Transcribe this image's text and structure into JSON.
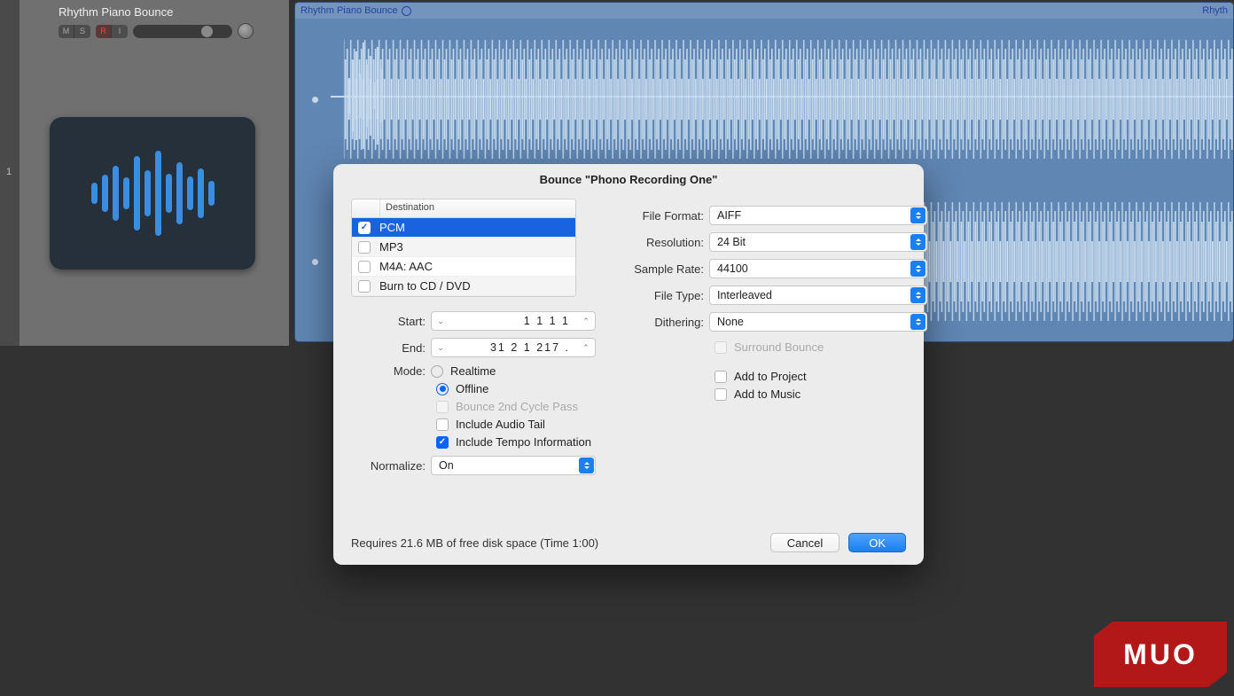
{
  "track": {
    "number": "1",
    "name": "Rhythm Piano Bounce",
    "buttons": {
      "m": "M",
      "s": "S",
      "r": "R",
      "i": "I"
    }
  },
  "clip": {
    "name_left": "Rhythm Piano Bounce",
    "name_right": "Rhyth"
  },
  "dialog": {
    "title": "Bounce \"Phono Recording One\"",
    "dest_header": "Destination",
    "destinations": [
      {
        "label": "PCM",
        "checked": true,
        "selected": true
      },
      {
        "label": "MP3",
        "checked": false,
        "selected": false
      },
      {
        "label": "M4A: AAC",
        "checked": false,
        "selected": false
      },
      {
        "label": "Burn to CD / DVD",
        "checked": false,
        "selected": false
      }
    ],
    "start_label": "Start:",
    "start_value": "1  1  1      1",
    "end_label": "End:",
    "end_value": "31  2  1  217 .",
    "mode_label": "Mode:",
    "mode_realtime": "Realtime",
    "mode_offline": "Offline",
    "bounce2nd": "Bounce 2nd Cycle Pass",
    "include_tail": "Include Audio Tail",
    "include_tempo": "Include Tempo Information",
    "normalize_label": "Normalize:",
    "normalize_value": "On",
    "file_format_label": "File Format:",
    "file_format_value": "AIFF",
    "resolution_label": "Resolution:",
    "resolution_value": "24 Bit",
    "sample_rate_label": "Sample Rate:",
    "sample_rate_value": "44100",
    "file_type_label": "File Type:",
    "file_type_value": "Interleaved",
    "dithering_label": "Dithering:",
    "dithering_value": "None",
    "surround": "Surround Bounce",
    "add_project": "Add to Project",
    "add_music": "Add to Music",
    "footer_status": "Requires 21.6 MB of free disk space  (Time 1:00)",
    "cancel": "Cancel",
    "ok": "OK"
  },
  "watermark": "MUO"
}
